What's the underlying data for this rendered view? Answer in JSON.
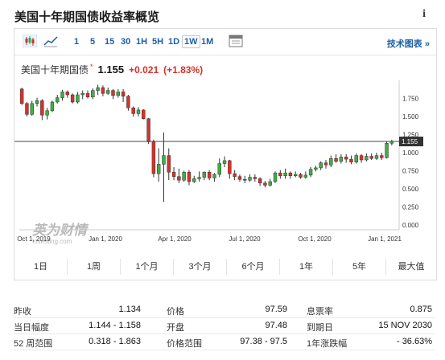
{
  "page": {
    "title": "美国十年期国债收益率概览",
    "info_icon": "info-icon"
  },
  "toolbar": {
    "intervals": [
      "1",
      "5",
      "15",
      "30",
      "1H",
      "5H",
      "1D",
      "1W",
      "1M"
    ],
    "active_interval": "1W",
    "advanced_chart": "技术图表 »"
  },
  "quote": {
    "name": "美国十年期国债",
    "star": "*",
    "price": "1.155",
    "change": "+0.021",
    "change_pct": "(+1.83%)"
  },
  "chart_data": {
    "type": "candlestick",
    "y_ticks": [
      "0.000",
      "0.250",
      "0.500",
      "0.750",
      "1.000",
      "1.250",
      "1.500",
      "1.750"
    ],
    "ylim": [
      0,
      2.0
    ],
    "x_ticks": [
      "Oct 1, 2019",
      "Jan 1, 2020",
      "Apr 1, 2020",
      "Jul 1, 2020",
      "Oct 1, 2020",
      "Jan 1, 2021"
    ],
    "current_value": "1.155",
    "colors": {
      "up": "#3cb043",
      "down": "#d9302a"
    },
    "candles": [
      [
        1.88,
        1.68,
        1.9,
        1.66
      ],
      [
        1.68,
        1.53,
        1.7,
        1.5
      ],
      [
        1.53,
        1.68,
        1.72,
        1.51
      ],
      [
        1.68,
        1.72,
        1.76,
        1.64
      ],
      [
        1.72,
        1.52,
        1.74,
        1.45
      ],
      [
        1.52,
        1.58,
        1.62,
        1.46
      ],
      [
        1.58,
        1.7,
        1.72,
        1.56
      ],
      [
        1.7,
        1.76,
        1.8,
        1.68
      ],
      [
        1.76,
        1.84,
        1.87,
        1.72
      ],
      [
        1.84,
        1.8,
        1.86,
        1.76
      ],
      [
        1.8,
        1.7,
        1.82,
        1.68
      ],
      [
        1.7,
        1.8,
        1.84,
        1.68
      ],
      [
        1.8,
        1.82,
        1.86,
        1.74
      ],
      [
        1.82,
        1.77,
        1.86,
        1.75
      ],
      [
        1.77,
        1.86,
        1.89,
        1.74
      ],
      [
        1.86,
        1.9,
        1.94,
        1.8
      ],
      [
        1.9,
        1.82,
        1.93,
        1.78
      ],
      [
        1.82,
        1.86,
        1.9,
        1.8
      ],
      [
        1.86,
        1.79,
        1.88,
        1.74
      ],
      [
        1.79,
        1.84,
        1.88,
        1.76
      ],
      [
        1.84,
        1.78,
        1.88,
        1.7
      ],
      [
        1.78,
        1.62,
        1.8,
        1.58
      ],
      [
        1.62,
        1.54,
        1.64,
        1.5
      ],
      [
        1.54,
        1.59,
        1.63,
        1.5
      ],
      [
        1.59,
        1.47,
        1.6,
        1.46
      ],
      [
        1.47,
        1.15,
        1.48,
        1.12
      ],
      [
        1.15,
        0.71,
        1.18,
        0.66
      ],
      [
        0.71,
        0.84,
        1.06,
        0.6
      ],
      [
        0.84,
        0.96,
        1.28,
        0.32
      ],
      [
        0.96,
        0.73,
        1.06,
        0.62
      ],
      [
        0.73,
        0.67,
        0.8,
        0.62
      ],
      [
        0.67,
        0.62,
        0.78,
        0.58
      ],
      [
        0.62,
        0.73,
        0.75,
        0.6
      ],
      [
        0.73,
        0.6,
        0.76,
        0.55
      ],
      [
        0.6,
        0.64,
        0.68,
        0.58
      ],
      [
        0.64,
        0.66,
        0.74,
        0.6
      ],
      [
        0.66,
        0.73,
        0.74,
        0.62
      ],
      [
        0.73,
        0.65,
        0.76,
        0.62
      ],
      [
        0.65,
        0.7,
        0.72,
        0.6
      ],
      [
        0.7,
        0.85,
        0.92,
        0.66
      ],
      [
        0.85,
        0.89,
        0.95,
        0.8
      ],
      [
        0.89,
        0.71,
        0.9,
        0.64
      ],
      [
        0.71,
        0.67,
        0.76,
        0.62
      ],
      [
        0.67,
        0.63,
        0.7,
        0.6
      ],
      [
        0.63,
        0.62,
        0.68,
        0.58
      ],
      [
        0.62,
        0.66,
        0.7,
        0.6
      ],
      [
        0.66,
        0.64,
        0.7,
        0.6
      ],
      [
        0.64,
        0.58,
        0.66,
        0.54
      ],
      [
        0.58,
        0.55,
        0.61,
        0.52
      ],
      [
        0.55,
        0.6,
        0.64,
        0.53
      ],
      [
        0.6,
        0.72,
        0.74,
        0.58
      ],
      [
        0.72,
        0.68,
        0.76,
        0.64
      ],
      [
        0.68,
        0.72,
        0.78,
        0.64
      ],
      [
        0.72,
        0.68,
        0.74,
        0.64
      ],
      [
        0.68,
        0.7,
        0.74,
        0.66
      ],
      [
        0.7,
        0.66,
        0.72,
        0.64
      ],
      [
        0.66,
        0.69,
        0.74,
        0.64
      ],
      [
        0.69,
        0.77,
        0.8,
        0.66
      ],
      [
        0.77,
        0.79,
        0.82,
        0.74
      ],
      [
        0.79,
        0.86,
        0.88,
        0.76
      ],
      [
        0.86,
        0.83,
        0.9,
        0.78
      ],
      [
        0.83,
        0.92,
        0.96,
        0.8
      ],
      [
        0.92,
        0.88,
        0.98,
        0.86
      ],
      [
        0.88,
        0.94,
        0.98,
        0.85
      ],
      [
        0.94,
        0.91,
        0.98,
        0.86
      ],
      [
        0.91,
        0.87,
        0.96,
        0.84
      ],
      [
        0.87,
        0.96,
        0.99,
        0.85
      ],
      [
        0.96,
        0.9,
        0.98,
        0.86
      ],
      [
        0.9,
        0.95,
        0.99,
        0.88
      ],
      [
        0.95,
        0.92,
        0.99,
        0.9
      ],
      [
        0.92,
        0.96,
        1.0,
        0.9
      ],
      [
        0.96,
        0.93,
        1.0,
        0.9
      ],
      [
        0.93,
        1.13,
        1.16,
        0.92
      ],
      [
        1.13,
        1.155,
        1.18,
        1.1
      ]
    ]
  },
  "range_buttons": [
    "1日",
    "1周",
    "1个月",
    "3个月",
    "6个月",
    "1年",
    "5年",
    "最大值"
  ],
  "stats": {
    "col1": [
      {
        "label": "昨收",
        "value": "1.134"
      },
      {
        "label": "当日幅度",
        "value": "1.144 - 1.158"
      },
      {
        "label": "52 周范围",
        "value": "0.318 - 1.863"
      }
    ],
    "col2": [
      {
        "label": "价格",
        "value": "97.59"
      },
      {
        "label": "开盘",
        "value": "97.48"
      },
      {
        "label": "价格范围",
        "value": "97.38 - 97.5"
      }
    ],
    "col3": [
      {
        "label": "息票率",
        "value": "0.875"
      },
      {
        "label": "到期日",
        "value": "15 NOV 2030"
      },
      {
        "label": "1年涨跌幅",
        "value": "- 36.63%"
      }
    ]
  }
}
